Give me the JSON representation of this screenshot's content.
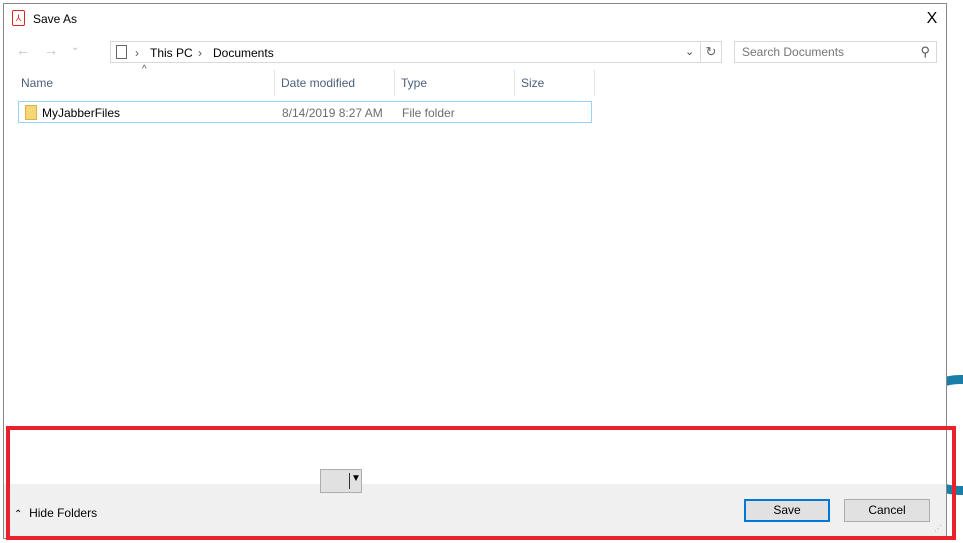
{
  "dialog": {
    "title": "Save As",
    "close_label": "X"
  },
  "nav": {
    "back": "←",
    "forward": "→",
    "recent": "⌄"
  },
  "address": {
    "crumbs": [
      "This PC",
      "Documents"
    ],
    "separator": "›"
  },
  "search": {
    "placeholder": "Search Documents"
  },
  "columns": [
    "Name",
    "Date modified",
    "Type",
    "Size"
  ],
  "files": [
    {
      "name": "MyJabberFiles",
      "date": "8/14/2019 8:27 AM",
      "type": "File folder",
      "size": ""
    }
  ],
  "footer": {
    "hide_folders": "Hide Folders",
    "save": "Save",
    "cancel": "Cancel"
  },
  "colors": {
    "highlight": "#e8212b",
    "accent": "#0078d7"
  }
}
